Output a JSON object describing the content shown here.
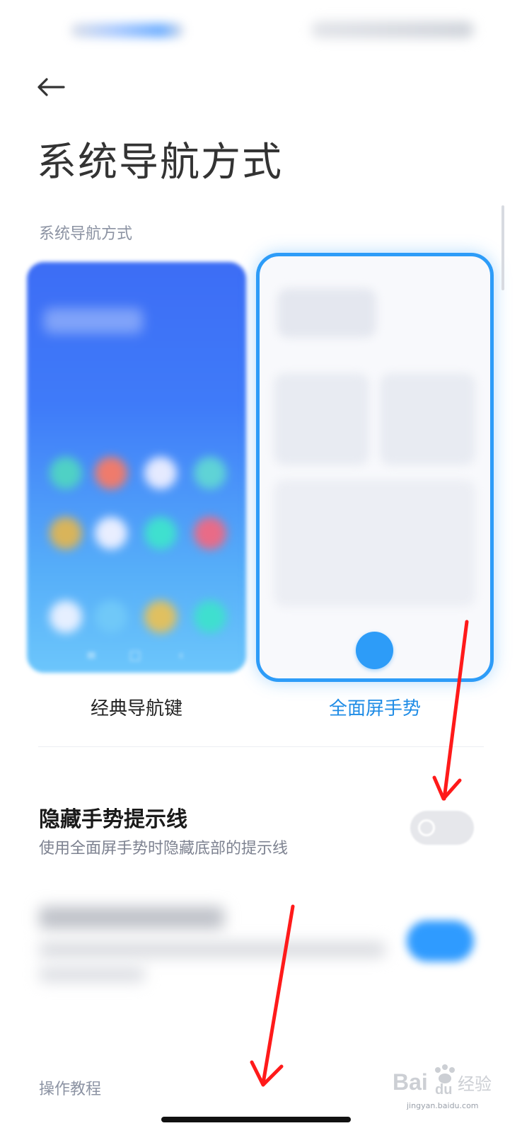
{
  "header": {
    "back_icon": "arrow-left-icon",
    "title": "系统导航方式"
  },
  "section": {
    "label": "系统导航方式"
  },
  "options": [
    {
      "label": "经典导航键",
      "selected": false
    },
    {
      "label": "全面屏手势",
      "selected": true
    }
  ],
  "hide_hint_setting": {
    "title": "隐藏手势提示线",
    "subtitle": "使用全面屏手势时隐藏底部的提示线",
    "enabled": false
  },
  "tutorial": {
    "label": "操作教程"
  },
  "watermark": {
    "brand": "Bai",
    "brand_suffix": "du",
    "site": "经验",
    "url": "jingyan.baidu.com"
  },
  "colors": {
    "accent": "#2d9cf8",
    "annotation_arrow": "#ff1a1a"
  }
}
